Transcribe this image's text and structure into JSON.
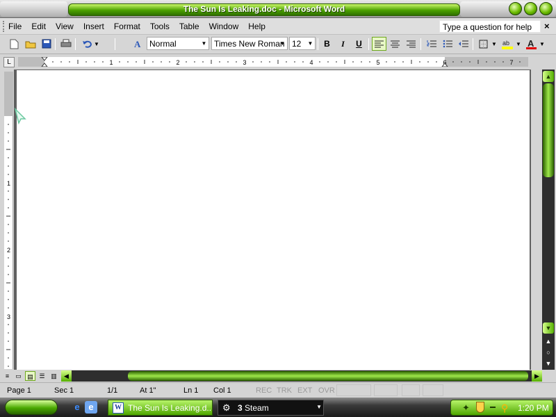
{
  "window": {
    "title": "The Sun Is Leaking.doc - Microsoft Word",
    "app_icon_letter": "W"
  },
  "menu": {
    "items": [
      "File",
      "Edit",
      "View",
      "Insert",
      "Format",
      "Tools",
      "Table",
      "Window",
      "Help"
    ],
    "help_placeholder": "Type a question for help",
    "close_label": "×"
  },
  "toolbar": {
    "style": "Normal",
    "font": "Times New Roman",
    "size": "12",
    "bold": "B",
    "italic": "I",
    "underline": "U",
    "active_alignment": "align-left"
  },
  "ruler": {
    "horizontal_numbers": [
      "1",
      "2",
      "3",
      "4",
      "5",
      "6",
      "7"
    ],
    "vertical_numbers": [
      "1",
      "2",
      "3"
    ],
    "tab_selector": "L"
  },
  "status": {
    "page": "Page 1",
    "section": "Sec 1",
    "pages": "1/1",
    "at": "At 1\"",
    "line": "Ln 1",
    "col": "Col 1",
    "rec": "REC",
    "trk": "TRK",
    "ext": "EXT",
    "ovr": "OVR"
  },
  "taskbar": {
    "word_task": "The Sun Is Leaking.d...",
    "steam_count": "3",
    "steam_task": "Steam",
    "clock": "1:20 PM"
  },
  "colors": {
    "accent": "#4ca100",
    "accent_light": "#c9f76a",
    "dark": "#2e2e2e"
  }
}
